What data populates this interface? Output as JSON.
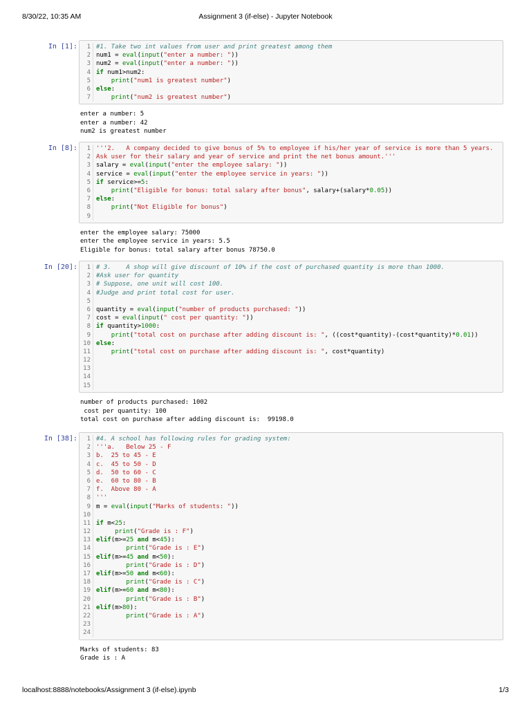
{
  "header": {
    "datetime": "8/30/22, 10:35 AM",
    "title": "Assignment 3 (if-else) - Jupyter Notebook"
  },
  "footer": {
    "url": "localhost:8888/notebooks/Assignment 3 (if-else).ipynb",
    "page": "1/3"
  },
  "cells": [
    {
      "prompt": "In [1]:",
      "code": [
        [
          [
            "cm",
            "#1. Take two int values from user and print greatest among them"
          ]
        ],
        [
          [
            "tx",
            "num1 = "
          ],
          [
            "nb",
            "eval"
          ],
          [
            "tx",
            "("
          ],
          [
            "nb",
            "input"
          ],
          [
            "tx",
            "("
          ],
          [
            "st",
            "\"enter a number: \""
          ],
          [
            "tx",
            "))"
          ]
        ],
        [
          [
            "tx",
            "num2 = "
          ],
          [
            "nb",
            "eval"
          ],
          [
            "tx",
            "("
          ],
          [
            "nb",
            "input"
          ],
          [
            "tx",
            "("
          ],
          [
            "st",
            "\"enter a number: \""
          ],
          [
            "tx",
            "))"
          ]
        ],
        [
          [
            "kw",
            "if"
          ],
          [
            "tx",
            " num1>num2:"
          ]
        ],
        [
          [
            "tx",
            "    "
          ],
          [
            "nb",
            "print"
          ],
          [
            "tx",
            "("
          ],
          [
            "st",
            "\"num1 is greatest number\""
          ],
          [
            "tx",
            ")"
          ]
        ],
        [
          [
            "kw",
            "else"
          ],
          [
            "tx",
            ":"
          ]
        ],
        [
          [
            "tx",
            "    "
          ],
          [
            "nb",
            "print"
          ],
          [
            "tx",
            "("
          ],
          [
            "st",
            "\"num2 is greatest number\""
          ],
          [
            "tx",
            ")"
          ]
        ]
      ],
      "output": [
        "enter a number: 5",
        "enter a number: 42",
        "num2 is greatest number"
      ]
    },
    {
      "prompt": "In [8]:",
      "code": [
        [
          [
            "st",
            "'''2.   A company decided to give bonus of 5% to employee if his/her year of service is more than 5 years."
          ]
        ],
        [
          [
            "st",
            "Ask user for their salary and year of service and print the net bonus amount.'''"
          ]
        ],
        [
          [
            "tx",
            "salary = "
          ],
          [
            "nb",
            "eval"
          ],
          [
            "tx",
            "("
          ],
          [
            "nb",
            "input"
          ],
          [
            "tx",
            "("
          ],
          [
            "st",
            "\"enter the employee salary: \""
          ],
          [
            "tx",
            "))"
          ]
        ],
        [
          [
            "tx",
            "service = "
          ],
          [
            "nb",
            "eval"
          ],
          [
            "tx",
            "("
          ],
          [
            "nb",
            "input"
          ],
          [
            "tx",
            "("
          ],
          [
            "st",
            "\"enter the employee service in years: \""
          ],
          [
            "tx",
            "))"
          ]
        ],
        [
          [
            "kw",
            "if"
          ],
          [
            "tx",
            " service>="
          ],
          [
            "nm",
            "5"
          ],
          [
            "tx",
            ":"
          ]
        ],
        [
          [
            "tx",
            "    "
          ],
          [
            "nb",
            "print"
          ],
          [
            "tx",
            "("
          ],
          [
            "st",
            "\"Eligible for bonus: total salary after bonus\""
          ],
          [
            "tx",
            ", salary+(salary*"
          ],
          [
            "nm",
            "0.05"
          ],
          [
            "tx",
            "))"
          ]
        ],
        [
          [
            "kw",
            "else"
          ],
          [
            "tx",
            ":"
          ]
        ],
        [
          [
            "tx",
            "    "
          ],
          [
            "nb",
            "print"
          ],
          [
            "tx",
            "("
          ],
          [
            "st",
            "\"Not Eligible for bonus\""
          ],
          [
            "tx",
            ")"
          ]
        ],
        []
      ],
      "output": [
        "enter the employee salary: 75000",
        "enter the employee service in years: 5.5",
        "Eligible for bonus: total salary after bonus 78750.0"
      ]
    },
    {
      "prompt": "In [20]:",
      "code": [
        [
          [
            "cm",
            "# 3.    A shop will give discount of 10% if the cost of purchased quantity is more than 1000."
          ]
        ],
        [
          [
            "cm",
            "#Ask user for quantity"
          ]
        ],
        [
          [
            "cm",
            "# Suppose, one unit will cost 100."
          ]
        ],
        [
          [
            "cm",
            "#Judge and print total cost for user."
          ]
        ],
        [],
        [
          [
            "tx",
            "quantity = "
          ],
          [
            "nb",
            "eval"
          ],
          [
            "tx",
            "("
          ],
          [
            "nb",
            "input"
          ],
          [
            "tx",
            "("
          ],
          [
            "st",
            "\"number of products purchased: \""
          ],
          [
            "tx",
            "))"
          ]
        ],
        [
          [
            "tx",
            "cost = "
          ],
          [
            "nb",
            "eval"
          ],
          [
            "tx",
            "("
          ],
          [
            "nb",
            "input"
          ],
          [
            "tx",
            "("
          ],
          [
            "st",
            "\" cost per quantity: \""
          ],
          [
            "tx",
            "))"
          ]
        ],
        [
          [
            "kw",
            "if"
          ],
          [
            "tx",
            " quantity>"
          ],
          [
            "nm",
            "1000"
          ],
          [
            "tx",
            ":"
          ]
        ],
        [
          [
            "tx",
            "    "
          ],
          [
            "nb",
            "print"
          ],
          [
            "tx",
            "("
          ],
          [
            "st",
            "\"total cost on purchase after adding discount is: \""
          ],
          [
            "tx",
            ", ((cost*quantity)-(cost*quantity)*"
          ],
          [
            "nm",
            "0.01"
          ],
          [
            "tx",
            "))"
          ]
        ],
        [
          [
            "kw",
            "else"
          ],
          [
            "tx",
            ":"
          ]
        ],
        [
          [
            "tx",
            "    "
          ],
          [
            "nb",
            "print"
          ],
          [
            "tx",
            "("
          ],
          [
            "st",
            "\"total cost on purchase after adding discount is: \""
          ],
          [
            "tx",
            ", cost*quantity)"
          ]
        ],
        [],
        [],
        [],
        []
      ],
      "output": [
        "number of products purchased: 1002",
        " cost per quantity: 100",
        "total cost on purchase after adding discount is:  99198.0"
      ]
    },
    {
      "prompt": "In [38]:",
      "code": [
        [
          [
            "cm",
            "#4. A school has following rules for grading system:"
          ]
        ],
        [
          [
            "st",
            "'''a.   Below 25 - F"
          ]
        ],
        [
          [
            "st",
            "b.  25 to 45 - E"
          ]
        ],
        [
          [
            "st",
            "c.  45 to 50 - D"
          ]
        ],
        [
          [
            "st",
            "d.  50 to 60 - C"
          ]
        ],
        [
          [
            "st",
            "e.  60 to 80 - B"
          ]
        ],
        [
          [
            "st",
            "f.  Above 80 - A"
          ]
        ],
        [
          [
            "st",
            "'''"
          ]
        ],
        [
          [
            "tx",
            "m = "
          ],
          [
            "nb",
            "eval"
          ],
          [
            "tx",
            "("
          ],
          [
            "nb",
            "input"
          ],
          [
            "tx",
            "("
          ],
          [
            "st",
            "\"Marks of students: \""
          ],
          [
            "tx",
            "))"
          ]
        ],
        [],
        [
          [
            "kw",
            "if"
          ],
          [
            "tx",
            " m<"
          ],
          [
            "nm",
            "25"
          ],
          [
            "tx",
            ":"
          ]
        ],
        [
          [
            "tx",
            "     "
          ],
          [
            "nb",
            "print"
          ],
          [
            "tx",
            "("
          ],
          [
            "st",
            "\"Grade is : F\""
          ],
          [
            "tx",
            ")"
          ]
        ],
        [
          [
            "kw",
            "elif"
          ],
          [
            "tx",
            "(m>="
          ],
          [
            "nm",
            "25"
          ],
          [
            "tx",
            " "
          ],
          [
            "kw",
            "and"
          ],
          [
            "tx",
            " m<"
          ],
          [
            "nm",
            "45"
          ],
          [
            "tx",
            "):"
          ]
        ],
        [
          [
            "tx",
            "        "
          ],
          [
            "nb",
            "print"
          ],
          [
            "tx",
            "("
          ],
          [
            "st",
            "\"Grade is : E\""
          ],
          [
            "tx",
            ")"
          ]
        ],
        [
          [
            "kw",
            "elif"
          ],
          [
            "tx",
            "(m>="
          ],
          [
            "nm",
            "45"
          ],
          [
            "tx",
            " "
          ],
          [
            "kw",
            "and"
          ],
          [
            "tx",
            " m<"
          ],
          [
            "nm",
            "50"
          ],
          [
            "tx",
            "):"
          ]
        ],
        [
          [
            "tx",
            "        "
          ],
          [
            "nb",
            "print"
          ],
          [
            "tx",
            "("
          ],
          [
            "st",
            "\"Grade is : D\""
          ],
          [
            "tx",
            ")"
          ]
        ],
        [
          [
            "kw",
            "elif"
          ],
          [
            "tx",
            "(m>="
          ],
          [
            "nm",
            "50"
          ],
          [
            "tx",
            " "
          ],
          [
            "kw",
            "and"
          ],
          [
            "tx",
            " m<"
          ],
          [
            "nm",
            "60"
          ],
          [
            "tx",
            "):"
          ]
        ],
        [
          [
            "tx",
            "        "
          ],
          [
            "nb",
            "print"
          ],
          [
            "tx",
            "("
          ],
          [
            "st",
            "\"Grade is : C\""
          ],
          [
            "tx",
            ")"
          ]
        ],
        [
          [
            "kw",
            "elif"
          ],
          [
            "tx",
            "(m>="
          ],
          [
            "nm",
            "60"
          ],
          [
            "tx",
            " "
          ],
          [
            "kw",
            "and"
          ],
          [
            "tx",
            " m<"
          ],
          [
            "nm",
            "80"
          ],
          [
            "tx",
            "):"
          ]
        ],
        [
          [
            "tx",
            "        "
          ],
          [
            "nb",
            "print"
          ],
          [
            "tx",
            "("
          ],
          [
            "st",
            "\"Grade is : B\""
          ],
          [
            "tx",
            ")"
          ]
        ],
        [
          [
            "kw",
            "elif"
          ],
          [
            "tx",
            "(m>"
          ],
          [
            "nm",
            "80"
          ],
          [
            "tx",
            "):"
          ]
        ],
        [
          [
            "tx",
            "        "
          ],
          [
            "nb",
            "print"
          ],
          [
            "tx",
            "("
          ],
          [
            "st",
            "\"Grade is : A\""
          ],
          [
            "tx",
            ")"
          ]
        ],
        [],
        []
      ],
      "output": [
        "Marks of students: 83",
        "Grade is : A"
      ]
    }
  ]
}
